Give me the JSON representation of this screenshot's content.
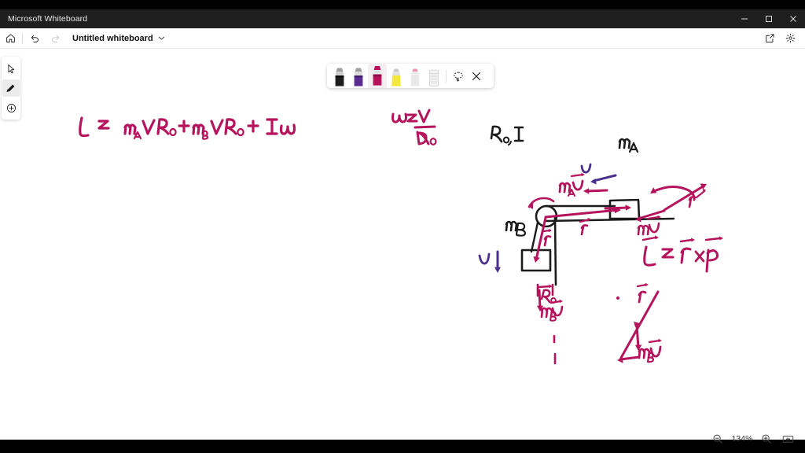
{
  "window": {
    "app_title": "Microsoft Whiteboard",
    "controls": [
      {
        "name": "minimize",
        "glyph": "minimize-icon"
      },
      {
        "name": "maximize",
        "glyph": "maximize-icon"
      },
      {
        "name": "close",
        "glyph": "close-icon"
      }
    ]
  },
  "commandbar": {
    "home_icon": "home-icon",
    "undo_icon": "undo-icon",
    "redo_icon": "redo-icon",
    "document_title": "Untitled whiteboard",
    "title_chevron": "chevron-down-icon",
    "share_icon": "share-icon",
    "settings_icon": "gear-icon"
  },
  "rail": {
    "items": [
      {
        "label": "Select",
        "icon": "cursor-arrow-icon",
        "active": false
      },
      {
        "label": "Pen",
        "icon": "pen-icon",
        "active": true
      },
      {
        "label": "Insert",
        "icon": "plus-circle-icon",
        "active": false
      }
    ]
  },
  "pen_toolbar": {
    "pens": [
      {
        "label": "Black pen",
        "icon": "pen-black-icon",
        "color": "#1e1e1e",
        "selected": false
      },
      {
        "label": "Purple pen",
        "icon": "pen-purple-icon",
        "color": "#5b2d90",
        "selected": false
      },
      {
        "label": "Magenta pen",
        "icon": "pen-magenta-icon",
        "color": "#b5145c",
        "selected": true
      },
      {
        "label": "Yellow highlighter",
        "icon": "highlighter-yellow-icon",
        "color": "#f4e93a",
        "selected": false
      },
      {
        "label": "Pink highlighter",
        "icon": "highlighter-pink-icon",
        "color": "#f291b6",
        "selected": false
      },
      {
        "label": "Eraser",
        "icon": "eraser-icon",
        "color": "#e8e8e8",
        "selected": false
      }
    ],
    "lasso_icon": "lasso-select-icon",
    "close_icon": "close-icon"
  },
  "zoom": {
    "zoom_out_icon": "zoom-out-icon",
    "level": "134%",
    "zoom_in_icon": "zoom-in-icon",
    "fit_icon": "fit-to-screen-icon"
  },
  "ink_colors": {
    "magenta": "#b5145c",
    "black": "#1b1b1b",
    "purple": "#4a2f8f"
  },
  "canvas": {
    "handwriting": [
      {
        "name": "angular-momentum-equation",
        "text": "L = m_A V R_0 + m_B V R_0 + I ω",
        "color": "#b5145c"
      },
      {
        "name": "omega-definition",
        "text": "ω = V / R_0",
        "color": "#b5145c"
      },
      {
        "name": "pulley-label",
        "text": "R_0 , I",
        "color": "#1b1b1b"
      },
      {
        "name": "block-a-label",
        "text": "m_A",
        "color": "#1b1b1b"
      },
      {
        "name": "block-b-label",
        "text": "m_B",
        "color": "#1b1b1b"
      },
      {
        "name": "velocity-top-label",
        "text": "v",
        "color": "#4a2f8f"
      },
      {
        "name": "velocity-left-label",
        "text": "V",
        "color": "#4a2f8f"
      },
      {
        "name": "momentum-a-label",
        "text": "m_A v⃗",
        "color": "#b5145c"
      },
      {
        "name": "momentum-b-label",
        "text": "m_B v⃗",
        "color": "#b5145c"
      },
      {
        "name": "radius-label-upper",
        "text": "r⃗",
        "color": "#b5145c"
      },
      {
        "name": "radius-label-lower",
        "text": "r⃗",
        "color": "#b5145c"
      },
      {
        "name": "radius-measure-label",
        "text": "R_0",
        "color": "#b5145c"
      },
      {
        "name": "cross-product-formula",
        "text": "L⃗ = r⃗ × p⃗",
        "color": "#b5145c"
      },
      {
        "name": "cross-product-r-label",
        "text": "r⃗",
        "color": "#b5145c"
      },
      {
        "name": "cross-product-mv-label",
        "text": "m v⃗",
        "color": "#b5145c"
      },
      {
        "name": "lower-r-label",
        "text": "r⃗",
        "color": "#b5145c"
      },
      {
        "name": "lower-mbv-label",
        "text": "m_B v⃗",
        "color": "#b5145c"
      }
    ]
  }
}
